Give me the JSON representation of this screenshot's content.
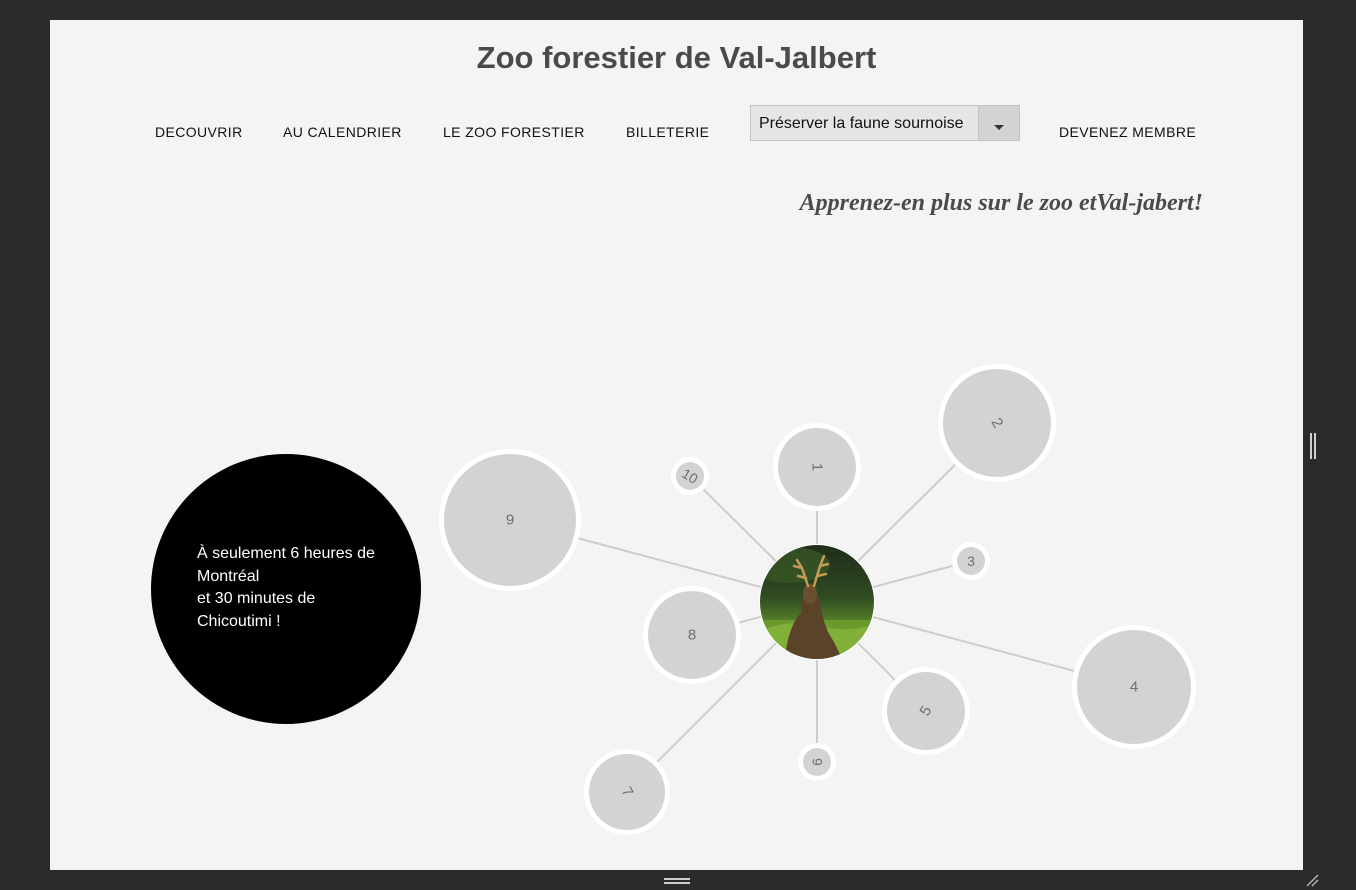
{
  "site": {
    "title": "Zoo forestier de Val-Jalbert"
  },
  "nav": {
    "decouvrir": "DECOUVRIR",
    "calendrier": "AU CALENDRIER",
    "zoo_forestier": "LE ZOO FORESTIER",
    "billeterie": "BILLETERIE",
    "select_value": "Préserver la faune sournoise",
    "membre": "DEVENEZ MEMBRE"
  },
  "tagline": "Apprenez-en plus sur le zoo etVal-jabert!",
  "info_circle": {
    "line1": "À seulement 6 heures de",
    "line2": "Montréal",
    "line3": "et 30 minutes de",
    "line4": "Chicoutimi !"
  },
  "bubble_graph": {
    "center_image": "deer-photo",
    "nodes": [
      {
        "label": "1"
      },
      {
        "label": "2"
      },
      {
        "label": "3"
      },
      {
        "label": "4"
      },
      {
        "label": "5"
      },
      {
        "label": "6"
      },
      {
        "label": "7"
      },
      {
        "label": "8"
      },
      {
        "label": "9"
      },
      {
        "label": "10"
      }
    ]
  },
  "colors": {
    "page_bg": "#f4f4f4",
    "frame_bg": "#2b2b2b",
    "bubble_fill": "#d3d3d3",
    "bubble_ring": "#ffffff",
    "link_line": "#cdcdcd",
    "info_circle_bg": "#000000"
  }
}
